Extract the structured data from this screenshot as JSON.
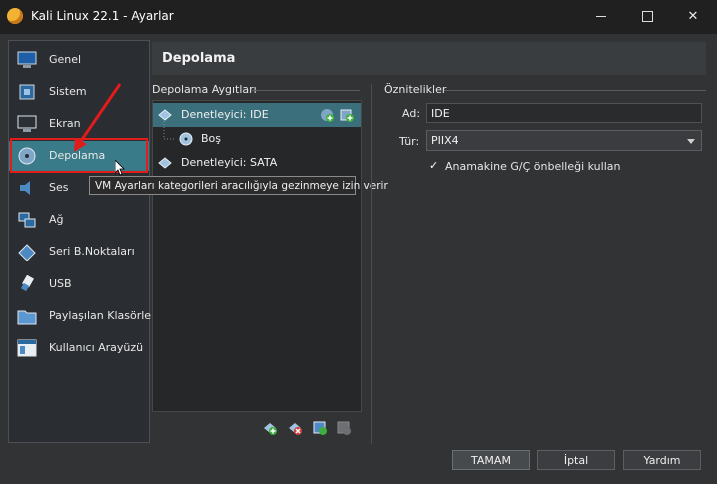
{
  "window": {
    "title": "Kali Linux 22.1 - Ayarlar"
  },
  "titlebar_buttons": {
    "minimize": "minimize-icon",
    "maximize": "maximize-icon",
    "close": "✕"
  },
  "sidebar": {
    "items": [
      {
        "label": "Genel",
        "icon": "monitor-general-icon"
      },
      {
        "label": "Sistem",
        "icon": "chip-icon"
      },
      {
        "label": "Ekran",
        "icon": "display-icon"
      },
      {
        "label": "Depolama",
        "icon": "disk-icon",
        "selected": true
      },
      {
        "label": "Ses",
        "icon": "speaker-icon"
      },
      {
        "label": "Ağ",
        "icon": "network-icon"
      },
      {
        "label": "Seri B.Noktaları",
        "icon": "serial-port-icon"
      },
      {
        "label": "USB",
        "icon": "usb-icon"
      },
      {
        "label": "Paylaşılan Klasörler",
        "icon": "folder-icon"
      },
      {
        "label": "Kullanıcı Arayüzü",
        "icon": "window-ui-icon"
      }
    ]
  },
  "page": {
    "heading": "Depolama"
  },
  "storage": {
    "group_label": "Depolama Aygıtları",
    "tree": [
      {
        "label": "Denetleyici: IDE",
        "selected": true
      },
      {
        "label": "Boş"
      },
      {
        "label": "Denetleyici: SATA"
      }
    ],
    "tooltip": "VM Ayarları kategorileri aracılığıyla gezinmeye izin verir"
  },
  "attributes": {
    "group_label": "Öznitelikler",
    "name_label": "Ad:",
    "name_value": "IDE",
    "type_label": "Tür:",
    "type_value": "PIIX4",
    "checkbox_label": "Anamakine G/Ç önbelleği kullan",
    "checkbox_checked": true
  },
  "buttons": {
    "ok": "TAMAM",
    "cancel": "İptal",
    "help": "Yardım"
  },
  "colors": {
    "selection": "#3a7b8a",
    "highlight_box": "#e21b1b",
    "arrow": "#e21b1b"
  }
}
